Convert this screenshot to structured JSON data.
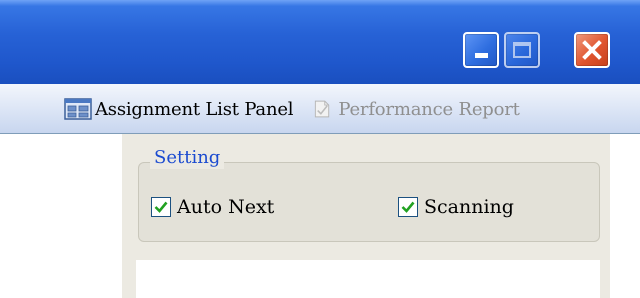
{
  "window": {
    "controls": [
      {
        "name": "minimize",
        "icon": "minimize-icon"
      },
      {
        "name": "maximize",
        "icon": "maximize-icon",
        "disabled": true
      },
      {
        "name": "close",
        "icon": "close-icon"
      }
    ],
    "titlebar_color": "#2762d6",
    "close_color": "#e0552f"
  },
  "toolbar": {
    "assignment_list": {
      "label": "Assignment List Panel",
      "icon": "grid-panel-icon"
    },
    "performance_report": {
      "label": "Performance Report",
      "icon": "report-document-icon",
      "disabled": true
    }
  },
  "settings": {
    "legend": "Setting",
    "legend_color": "#1b4bd0",
    "auto_next": {
      "label": "Auto Next",
      "checked": true
    },
    "scanning": {
      "label": "Scanning",
      "checked": true
    }
  }
}
